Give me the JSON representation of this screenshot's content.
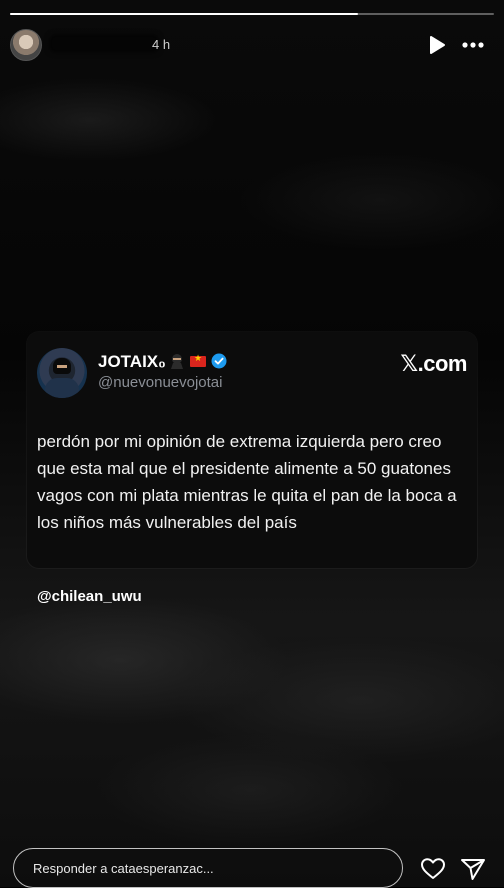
{
  "story": {
    "progress": 0.72,
    "time_ago": "4 h"
  },
  "tweet": {
    "display_name": "JOTAIX₀",
    "handle": "@nuevonuevojotai",
    "source_label": ".com",
    "text": "perdón por mi opinión de extrema izquierda pero creo que esta mal que el presidente alimente a 50 guatones vagos con mi plata mientras le quita el pan de la boca a los niños más vulnerables del país",
    "icons": [
      "ninja-emoji-icon",
      "vietnam-flag-icon",
      "verified-badge-icon"
    ]
  },
  "mention": "@chilean_uwu",
  "reply": {
    "placeholder": "Responder a cataesperanzac..."
  },
  "colors": {
    "accent_verified": "#1d9bf0",
    "handle_gray": "#8b8f96"
  }
}
